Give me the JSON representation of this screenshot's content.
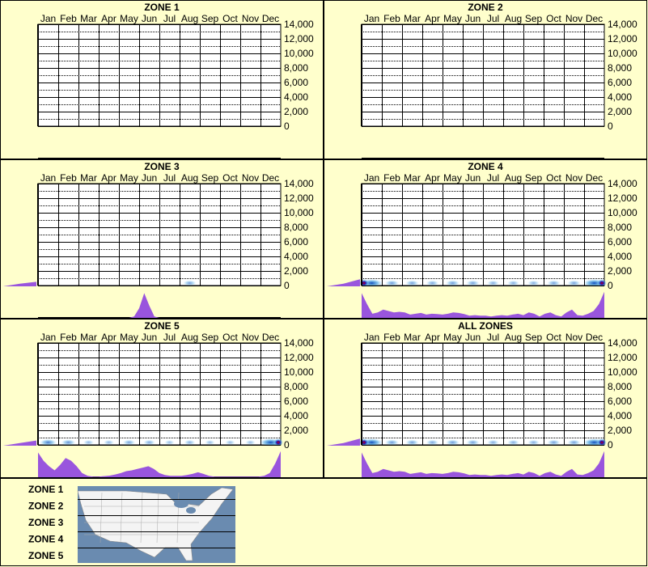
{
  "months": [
    "Jan",
    "Feb",
    "Mar",
    "Apr",
    "May",
    "Jun",
    "Jul",
    "Aug",
    "Sep",
    "Oct",
    "Nov",
    "Dec"
  ],
  "y_ticks": [
    "14,000",
    "12,000",
    "10,000",
    "8,000",
    "6,000",
    "4,000",
    "2,000",
    "0"
  ],
  "colors": {
    "background": "#FFFFCC",
    "fill_purple": "#9955DD",
    "heat_blue": "#0044CC",
    "heat_red": "#CC0000",
    "map_water": "#6A8BB0",
    "map_land": "#F4F4F4"
  },
  "chart_data": [
    {
      "type": "heatmap",
      "title": "ZONE 1",
      "ylim": [
        0,
        14000
      ],
      "monthly_intensity": [
        0,
        0,
        0,
        0,
        0,
        0,
        0,
        0,
        0,
        0,
        0,
        0
      ],
      "side_profile": [],
      "bottom_profile": []
    },
    {
      "type": "heatmap",
      "title": "ZONE 2",
      "ylim": [
        0,
        14000
      ],
      "monthly_intensity": [
        0,
        0,
        0,
        0,
        0,
        0,
        0,
        0,
        0,
        0,
        0,
        0
      ],
      "side_profile": [],
      "bottom_profile": []
    },
    {
      "type": "heatmap",
      "title": "ZONE 3",
      "ylim": [
        0,
        14000
      ],
      "monthly_intensity": [
        0,
        0,
        0,
        0,
        0,
        0,
        0,
        0.3,
        0,
        0,
        0,
        0
      ],
      "side_profile": [
        0,
        0.2,
        0.35
      ],
      "bottom_profile": [
        0,
        0,
        0,
        0,
        0,
        0,
        0,
        0,
        0,
        0,
        0,
        0,
        0,
        0,
        0,
        0,
        0,
        0,
        0,
        0.05,
        0.35,
        0.9,
        0.45,
        0.05,
        0,
        0,
        0,
        0,
        0,
        0,
        0,
        0,
        0,
        0,
        0,
        0,
        0,
        0,
        0,
        0,
        0,
        0,
        0,
        0,
        0,
        0,
        0,
        0,
        0
      ]
    },
    {
      "type": "heatmap",
      "title": "ZONE 4",
      "ylim": [
        0,
        14000
      ],
      "monthly_intensity": [
        1,
        0.35,
        0.3,
        0.25,
        0.35,
        0.3,
        0.2,
        0.2,
        0.2,
        0.3,
        0.3,
        1
      ],
      "side_profile": [
        0,
        0.2,
        0.55
      ],
      "bottom_profile": [
        0.9,
        0.5,
        0.15,
        0.2,
        0.3,
        0.25,
        0.2,
        0.22,
        0.2,
        0.12,
        0.15,
        0.18,
        0.12,
        0.15,
        0.14,
        0.12,
        0.15,
        0.2,
        0.18,
        0.14,
        0.08,
        0.1,
        0.08,
        0.08,
        0.05,
        0.08,
        0.1,
        0.08,
        0.12,
        0.15,
        0.1,
        0.2,
        0.15,
        0.05,
        0.15,
        0.2,
        0.1,
        0.05,
        0.2,
        0.3,
        0.1,
        0.08,
        0.15,
        0.25,
        0.5,
        0.95
      ]
    },
    {
      "type": "heatmap",
      "title": "ZONE 5",
      "ylim": [
        0,
        14000
      ],
      "monthly_intensity": [
        0.6,
        0.4,
        0.1,
        0.1,
        0.25,
        0.2,
        0.05,
        0.15,
        0.05,
        0.05,
        0.05,
        1
      ],
      "side_profile": [
        0,
        0.2,
        0.4
      ],
      "bottom_profile": [
        0.9,
        0.6,
        0.4,
        0.25,
        0.45,
        0.7,
        0.6,
        0.4,
        0.15,
        0.05,
        0.02,
        0.02,
        0.04,
        0.06,
        0.1,
        0.15,
        0.22,
        0.25,
        0.3,
        0.35,
        0.4,
        0.3,
        0.15,
        0.08,
        0.05,
        0.05,
        0.05,
        0.08,
        0.12,
        0.18,
        0.12,
        0.05,
        0.02,
        0.02,
        0.02,
        0.02,
        0.02,
        0.02,
        0.02,
        0.02,
        0.02,
        0.05,
        0.15,
        0.5,
        0.95
      ]
    },
    {
      "type": "heatmap",
      "title": "ALL ZONES",
      "ylim": [
        0,
        14000
      ],
      "monthly_intensity": [
        1,
        0.35,
        0.3,
        0.25,
        0.35,
        0.3,
        0.2,
        0.2,
        0.2,
        0.3,
        0.3,
        1
      ],
      "side_profile": [
        0,
        0.2,
        0.55
      ],
      "bottom_profile": [
        0.9,
        0.5,
        0.15,
        0.2,
        0.3,
        0.25,
        0.2,
        0.22,
        0.2,
        0.12,
        0.15,
        0.18,
        0.12,
        0.15,
        0.14,
        0.12,
        0.15,
        0.2,
        0.18,
        0.14,
        0.08,
        0.1,
        0.08,
        0.08,
        0.05,
        0.08,
        0.1,
        0.08,
        0.12,
        0.15,
        0.1,
        0.2,
        0.15,
        0.05,
        0.15,
        0.2,
        0.1,
        0.05,
        0.2,
        0.3,
        0.1,
        0.08,
        0.15,
        0.25,
        0.5,
        0.95
      ]
    }
  ],
  "legend": {
    "zones": [
      "ZONE 1",
      "ZONE 2",
      "ZONE 3",
      "ZONE 4",
      "ZONE 5"
    ]
  }
}
